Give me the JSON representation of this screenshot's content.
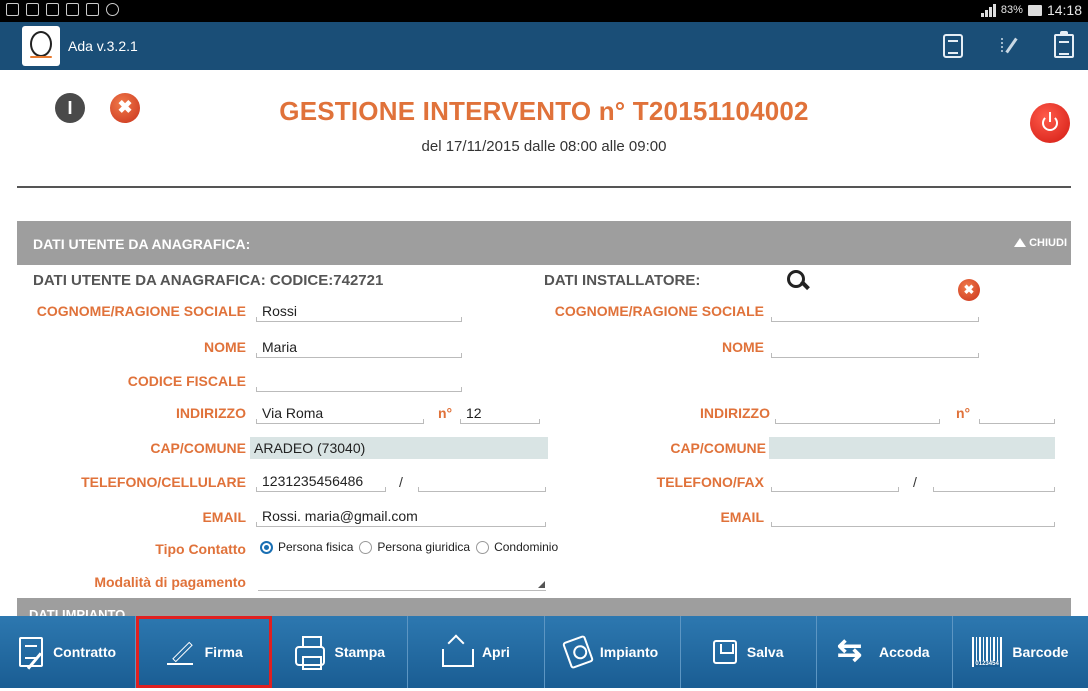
{
  "status_bar": {
    "battery": "83%",
    "time": "14:18"
  },
  "app": {
    "version": "Ada v.3.2.1"
  },
  "header": {
    "title": "GESTIONE INTERVENTO n° T20151104002",
    "subtitle": "del 17/11/2015 dalle 08:00 alle 09:00",
    "info_glyph": "I",
    "close_glyph": "✖"
  },
  "section": {
    "title": "DATI UTENTE DA ANAGRAFICA:",
    "toggle": "CHIUDI",
    "next_title_peek": "DATI IMPIANTO"
  },
  "user": {
    "heading": "DATI UTENTE DA ANAGRAFICA:  CODICE:742721",
    "labels": {
      "cognome": "COGNOME/RAGIONE SOCIALE",
      "nome": "NOME",
      "codice_fiscale": "CODICE FISCALE",
      "indirizzo": "INDIRIZZO",
      "numero": "n°",
      "cap_comune": "CAP/COMUNE",
      "telefono": "TELEFONO/CELLULARE",
      "email": "EMAIL",
      "tipo_contatto": "Tipo Contatto",
      "modalita_pagamento": "Modalità di pagamento"
    },
    "values": {
      "cognome": "Rossi",
      "nome": "Maria",
      "codice_fiscale": "",
      "indirizzo": "Via Roma",
      "numero": "12",
      "cap_comune": "ARADEO (73040)",
      "telefono": "1231235456486",
      "telefono_sep": "/",
      "cellulare": "",
      "email": "Rossi. maria@gmail.com",
      "modalita_pagamento": ""
    },
    "tipo_contatto_options": [
      "Persona fisica",
      "Persona giuridica",
      "Condominio"
    ],
    "tipo_contatto_selected": "Persona fisica"
  },
  "installer": {
    "heading": "DATI INSTALLATORE:",
    "close_glyph": "✖",
    "labels": {
      "cognome": "COGNOME/RAGIONE SOCIALE",
      "nome": "NOME",
      "indirizzo": "INDIRIZZO",
      "numero": "n°",
      "cap_comune": "CAP/COMUNE",
      "telefono": "TELEFONO/FAX",
      "email": "EMAIL"
    },
    "telefono_sep": "/"
  },
  "toolbar": {
    "items": [
      {
        "label": "Contratto",
        "icon": "contract-icon"
      },
      {
        "label": "Firma",
        "icon": "pen-icon",
        "active": true
      },
      {
        "label": "Stampa",
        "icon": "printer-icon"
      },
      {
        "label": "Apri",
        "icon": "upload-icon"
      },
      {
        "label": "Impianto",
        "icon": "plant-icon"
      },
      {
        "label": "Salva",
        "icon": "save-icon"
      },
      {
        "label": "Accoda",
        "icon": "arrows-icon"
      },
      {
        "label": "Barcode",
        "icon": "barcode-icon"
      }
    ]
  },
  "colors": {
    "accent": "#e0723a",
    "appbar": "#1a4e77",
    "toolbar": "#2d78b0",
    "highlight": "#e02020"
  }
}
